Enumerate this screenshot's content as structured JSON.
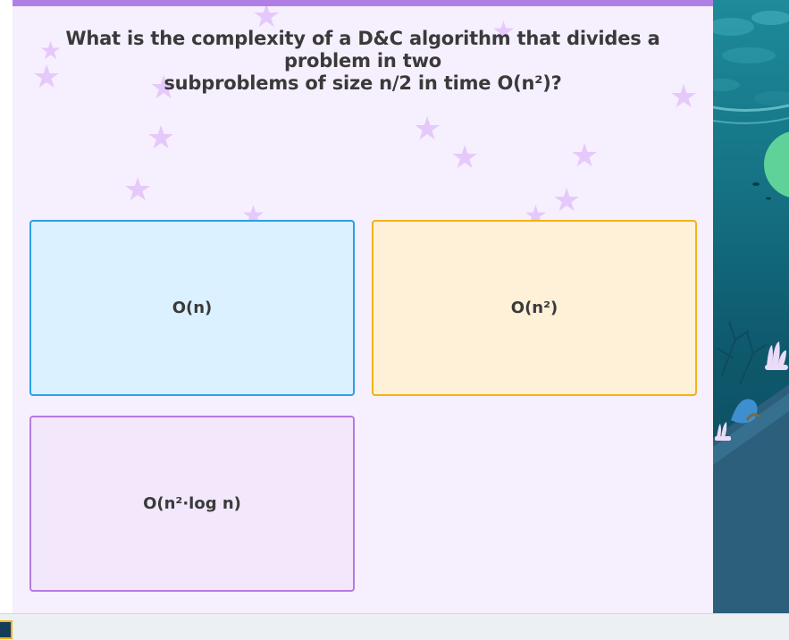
{
  "question": {
    "line1": "What is the complexity of a D&C algorithm that divides a problem in two",
    "line2": "subproblems of size n/2 in time O(n²)?"
  },
  "options": [
    {
      "label": "O(n)",
      "color": "#2aa1e6"
    },
    {
      "label": "O(n²)",
      "color": "#f2b317"
    },
    {
      "label": "O(n²·log n)",
      "color": "#b57be0"
    }
  ],
  "theme": {
    "accent": "#b07fe6",
    "panel_bg": "#f6effd",
    "star_color": "#e6c9fb"
  },
  "icons": [
    "star-icon",
    "ocean-scene",
    "coral-icon",
    "fish-icon"
  ]
}
